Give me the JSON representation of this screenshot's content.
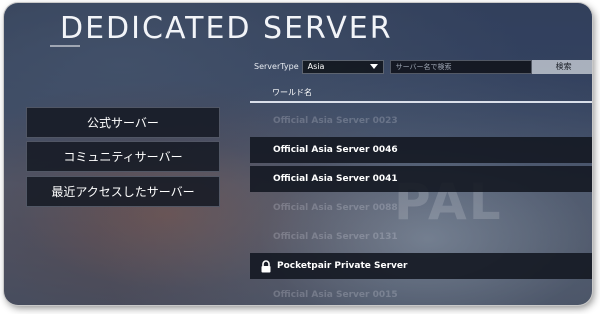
{
  "page": {
    "title": "DEDICATED SERVER",
    "watermark": "PAL"
  },
  "menu": {
    "items": [
      {
        "label": "公式サーバー"
      },
      {
        "label": "コミュニティサーバー"
      },
      {
        "label": "最近アクセスしたサーバー"
      }
    ]
  },
  "filter": {
    "server_type_label": "ServerType",
    "server_type_value": "Asia",
    "search_placeholder": "サーバー名で検索",
    "search_button": "検索"
  },
  "list": {
    "header": "ワールド名",
    "rows": [
      {
        "name": "Official Asia Server 0023",
        "style": "faded"
      },
      {
        "name": "Official Asia Server 0046",
        "style": "dark"
      },
      {
        "name": "Official Asia Server 0041",
        "style": "dark"
      },
      {
        "name": "Official Asia Server 0088",
        "style": "faded"
      },
      {
        "name": "Official Asia Server 0131",
        "style": "faded"
      },
      {
        "name": "Pocketpair Private Server",
        "style": "dark",
        "locked": true
      },
      {
        "name": "Official Asia Server 0015",
        "style": "faded"
      }
    ]
  }
}
